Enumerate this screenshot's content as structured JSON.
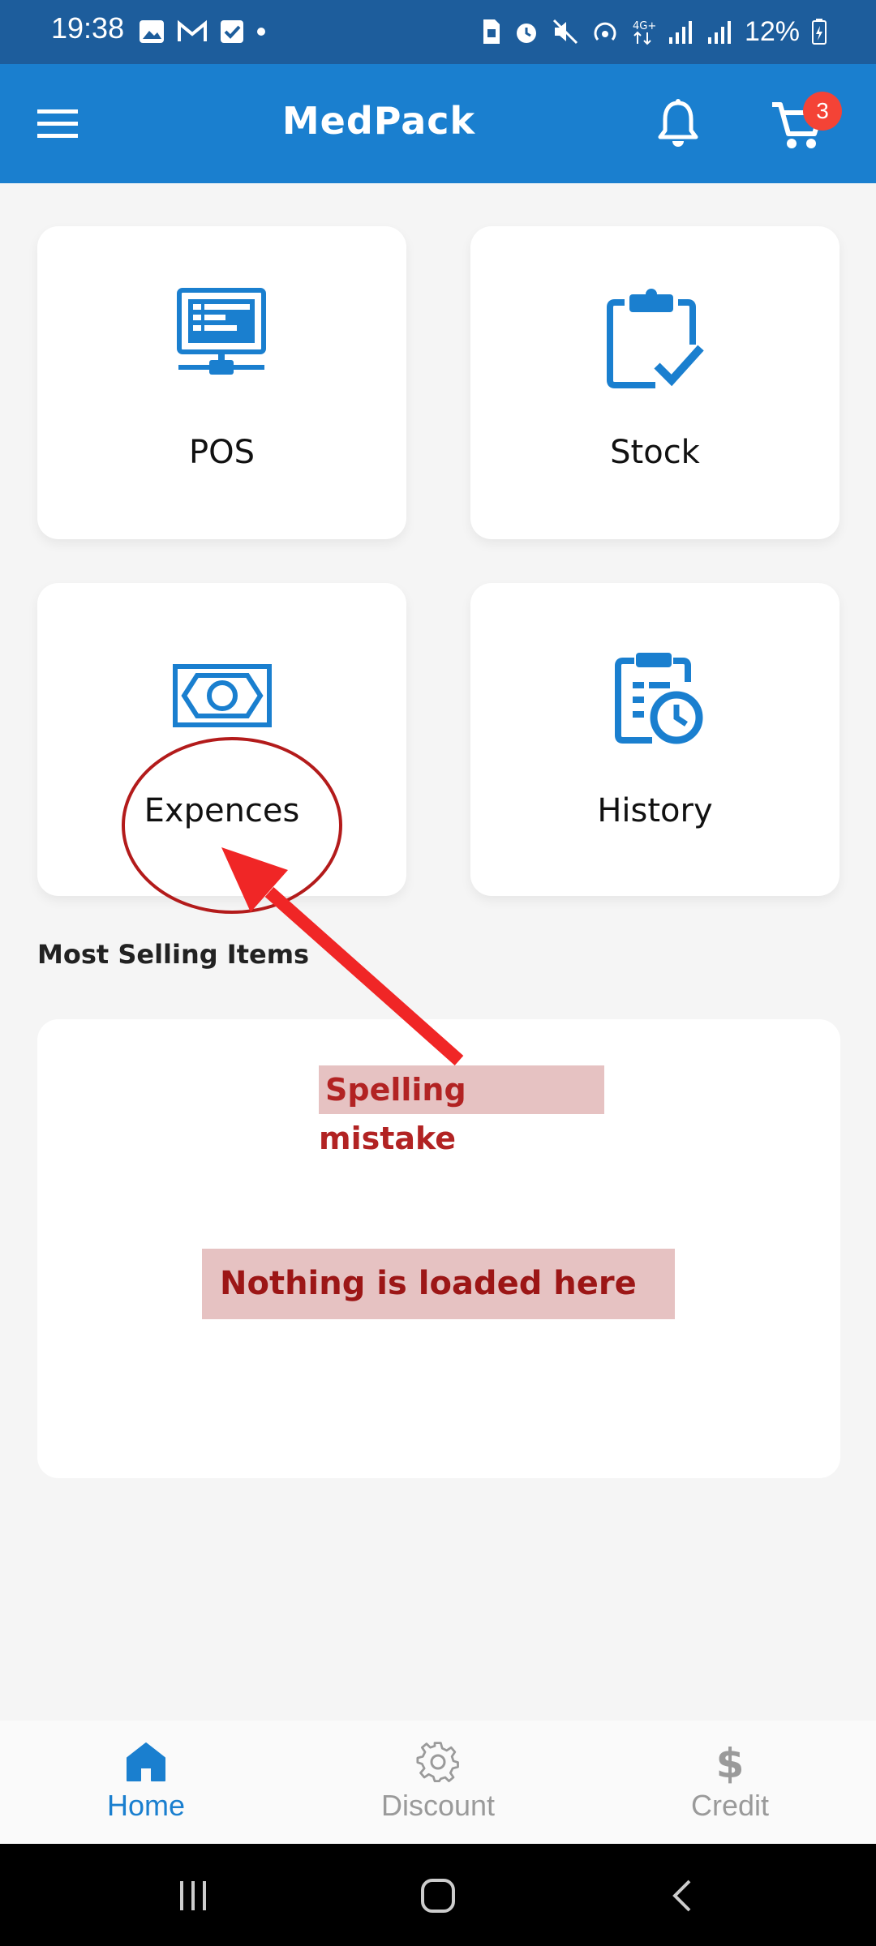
{
  "status_bar": {
    "time": "19:38",
    "battery": "12%"
  },
  "app_bar": {
    "title": "MedPack",
    "cart_count": "3",
    "icons": [
      "menu-icon",
      "bell-icon",
      "cart-icon"
    ]
  },
  "tiles": [
    {
      "label": "POS",
      "icon": "pos-terminal-icon"
    },
    {
      "label": "Stock",
      "icon": "clipboard-check-icon"
    },
    {
      "label": "Expences",
      "icon": "money-bill-icon"
    },
    {
      "label": "History",
      "icon": "clipboard-clock-icon"
    }
  ],
  "section": {
    "most_selling_title": "Most Selling Items"
  },
  "annotations": {
    "spelling": "Spelling mistake",
    "empty": "Nothing is loaded here"
  },
  "bottom_nav": [
    {
      "label": "Home",
      "icon": "home-icon",
      "active": true
    },
    {
      "label": "Discount",
      "icon": "gear-icon",
      "active": false
    },
    {
      "label": "Credit",
      "icon": "dollar-icon",
      "active": false
    }
  ],
  "colors": {
    "primary": "#1a7fcf",
    "status_bar": "#1d5d9c",
    "badge": "#f44336",
    "annotation": "#e02020",
    "inactive": "#9a9a9a"
  }
}
